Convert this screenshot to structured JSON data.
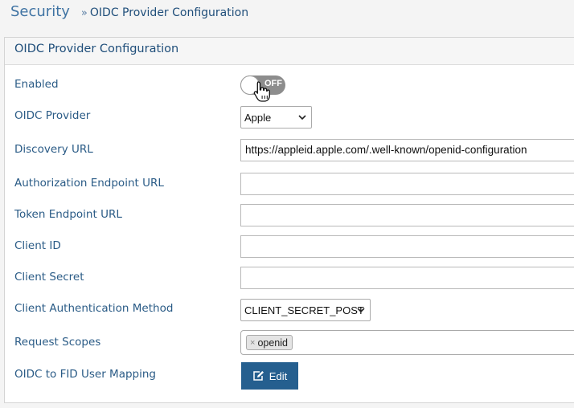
{
  "breadcrumb": {
    "root": "Security",
    "separator": "»",
    "current": "OIDC Provider Configuration"
  },
  "panel": {
    "title": "OIDC Provider Configuration"
  },
  "form": {
    "enabled": {
      "label": "Enabled",
      "toggle_text": "OFF",
      "state": "off"
    },
    "oidc_provider": {
      "label": "OIDC Provider",
      "value": "Apple"
    },
    "discovery_url": {
      "label": "Discovery URL",
      "value": "https://appleid.apple.com/.well-known/openid-configuration"
    },
    "authorization_endpoint_url": {
      "label": "Authorization Endpoint URL",
      "value": ""
    },
    "token_endpoint_url": {
      "label": "Token Endpoint URL",
      "value": ""
    },
    "client_id": {
      "label": "Client ID",
      "value": ""
    },
    "client_secret": {
      "label": "Client Secret",
      "value": ""
    },
    "client_auth_method": {
      "label": "Client Authentication Method",
      "value": "CLIENT_SECRET_POST"
    },
    "request_scopes": {
      "label": "Request Scopes",
      "tags": [
        "openid"
      ],
      "remove_symbol": "×"
    },
    "user_mapping": {
      "label": "OIDC to FID User Mapping",
      "button_label": "Edit"
    }
  },
  "icons": {
    "toggle_cursor": "hand-pointer-icon",
    "select_caret": "chevron-down-icon",
    "edit": "edit-icon"
  },
  "colors": {
    "accent": "#255f8f",
    "label_text": "#2a5b86",
    "toggle_off": "#8d8d8d"
  }
}
